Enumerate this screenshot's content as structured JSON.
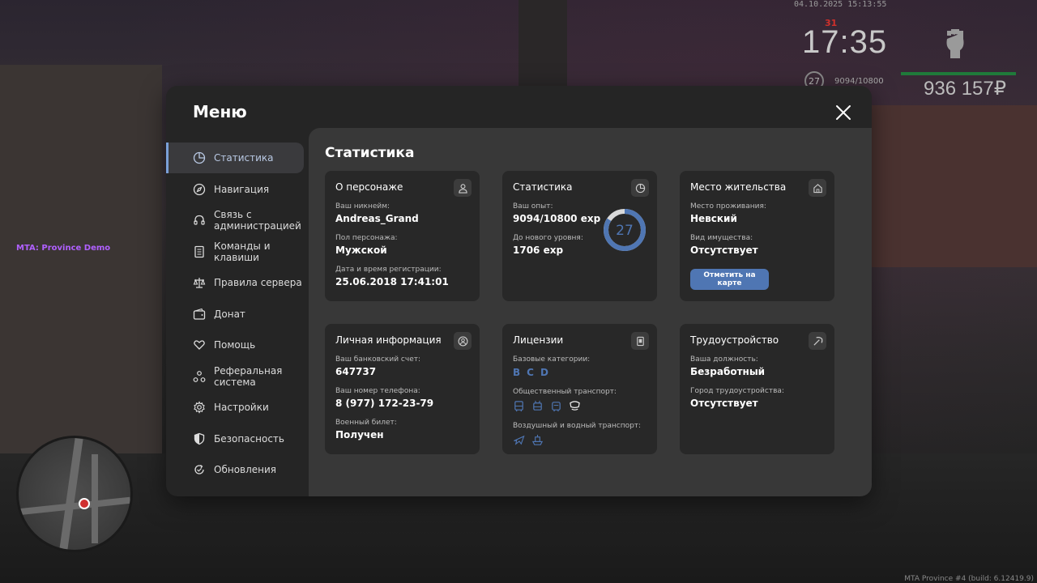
{
  "hud": {
    "timestamp": "04.10.2025 15:13:55",
    "red_number": "31",
    "clock": "17:35",
    "level": "27",
    "exp": "9094/10800",
    "money": "936 157₽"
  },
  "server_label": "MTA: Province Demo",
  "build_label": "MTA Province #4 (build: 6.12419.9)",
  "menu": {
    "title": "Меню",
    "nav": [
      {
        "label": "Статистика",
        "icon": "pie-chart-icon"
      },
      {
        "label": "Навигация",
        "icon": "compass-icon"
      },
      {
        "label": "Связь с администрацией",
        "icon": "headset-icon"
      },
      {
        "label": "Команды и клавиши",
        "icon": "document-icon"
      },
      {
        "label": "Правила сервера",
        "icon": "scales-icon"
      },
      {
        "label": "Донат",
        "icon": "wallet-icon"
      },
      {
        "label": "Помощь",
        "icon": "heart-hand-icon"
      },
      {
        "label": "Реферальная система",
        "icon": "referral-icon"
      },
      {
        "label": "Настройки",
        "icon": "gear-icon"
      },
      {
        "label": "Безопасность",
        "icon": "shield-icon"
      },
      {
        "label": "Обновления",
        "icon": "update-icon"
      }
    ]
  },
  "content": {
    "title": "Статистика",
    "character": {
      "title": "О персонаже",
      "nickname_label": "Ваш никнейм:",
      "nickname": "Andreas_Grand",
      "gender_label": "Пол персонажа:",
      "gender": "Мужской",
      "reg_label": "Дата и время регистрации:",
      "reg": "25.06.2018 17:41:01"
    },
    "stats": {
      "title": "Статистика",
      "exp_label": "Ваш опыт:",
      "exp": "9094/10800 exp",
      "next_label": "До нового уровня:",
      "next": "1706 exp",
      "level": "27",
      "progress": 0.842
    },
    "residence": {
      "title": "Место жительства",
      "place_label": "Место проживания:",
      "place": "Невский",
      "property_label": "Вид имущества:",
      "property": "Отсутствует",
      "button": "Отметить на карте"
    },
    "personal": {
      "title": "Личная информация",
      "bank_label": "Ваш банковский счет:",
      "bank": "647737",
      "phone_label": "Ваш номер телефона:",
      "phone": "8 (977) 172-23-79",
      "military_label": "Военный билет:",
      "military": "Получен"
    },
    "licenses": {
      "title": "Лицензии",
      "base_label": "Базовые категории:",
      "base": [
        "B",
        "C",
        "D"
      ],
      "public_label": "Общественный транспорт:",
      "air_label": "Воздушный и водный транспорт:"
    },
    "employment": {
      "title": "Трудоустройство",
      "position_label": "Ваша должность:",
      "position": "Безработный",
      "city_label": "Город трудоустройства:",
      "city": "Отсутствует"
    }
  },
  "colors": {
    "accent": "#4f76b3",
    "active_bar": "#7aa0d8",
    "card_bg": "#282828",
    "panel_bg": "#383838"
  }
}
